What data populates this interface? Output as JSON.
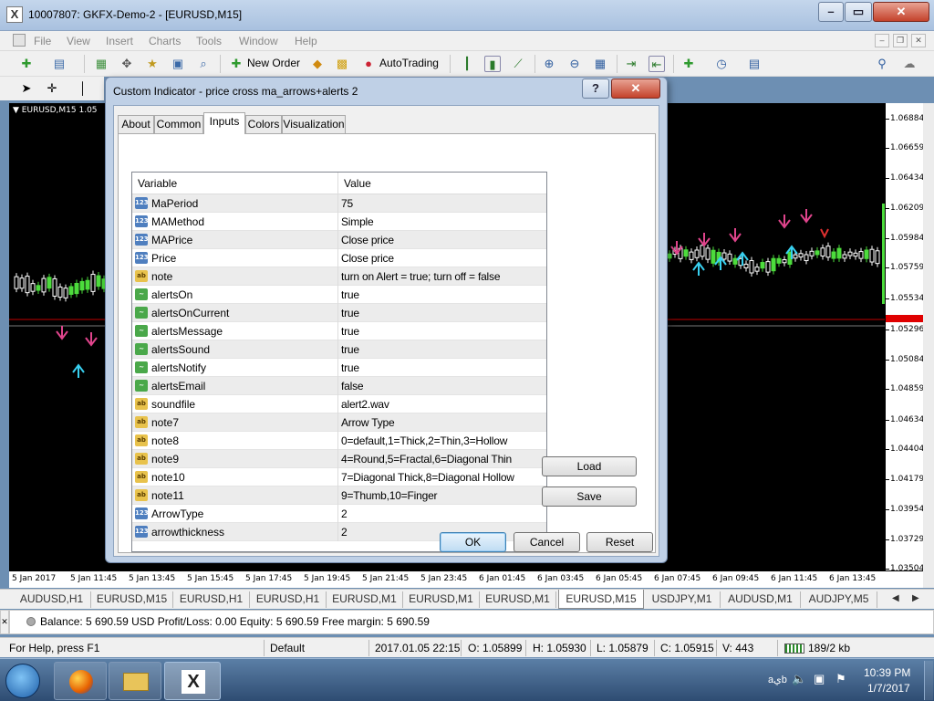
{
  "window": {
    "title": "10007807: GKFX-Demo-2 - [EURUSD,M15]",
    "app_icon": "X"
  },
  "menu": [
    "File",
    "View",
    "Insert",
    "Charts",
    "Tools",
    "Window",
    "Help"
  ],
  "toolbar": {
    "new_order": "New Order",
    "auto_trading": "AutoTrading"
  },
  "chart": {
    "label": "EURUSD,M15  1.05",
    "prices": [
      "1.06884",
      "1.06659",
      "1.06434",
      "1.06209",
      "1.05984",
      "1.05759",
      "1.05534",
      "1.05296",
      "1.05084",
      "1.04859",
      "1.04634",
      "1.04404",
      "1.04179",
      "1.03954",
      "1.03729",
      "1.03504"
    ],
    "current_price": "1.05296",
    "times": [
      "5 Jan 2017",
      "5 Jan 11:45",
      "5 Jan 13:45",
      "5 Jan 15:45",
      "5 Jan 17:45",
      "5 Jan 19:45",
      "5 Jan 21:45",
      "5 Jan 23:45",
      "6 Jan 01:45",
      "6 Jan 03:45",
      "6 Jan 05:45",
      "6 Jan 07:45",
      "6 Jan 09:45",
      "6 Jan 11:45",
      "6 Jan 13:45"
    ],
    "colors": {
      "bull": "#4cdc3c",
      "bear": "#ffffff",
      "up_arrow": "#38d0f0",
      "down_arrow": "#e0448c"
    }
  },
  "dialog": {
    "title": "Custom Indicator - price cross ma_arrows+alerts 2",
    "help_glyph": "?",
    "tabs": [
      "About",
      "Common",
      "Inputs",
      "Colors",
      "Visualization"
    ],
    "active_tab": "Inputs",
    "columns": {
      "variable": "Variable",
      "value": "Value"
    },
    "rows": [
      {
        "type": "int",
        "name": "MaPeriod",
        "value": "75"
      },
      {
        "type": "int",
        "name": "MAMethod",
        "value": "Simple"
      },
      {
        "type": "int",
        "name": "MAPrice",
        "value": "Close price"
      },
      {
        "type": "int",
        "name": "Price",
        "value": "Close price"
      },
      {
        "type": "str",
        "name": "note",
        "value": "turn on Alert = true; turn off = false"
      },
      {
        "type": "bool",
        "name": "alertsOn",
        "value": "true"
      },
      {
        "type": "bool",
        "name": "alertsOnCurrent",
        "value": "true"
      },
      {
        "type": "bool",
        "name": "alertsMessage",
        "value": "true"
      },
      {
        "type": "bool",
        "name": "alertsSound",
        "value": "true"
      },
      {
        "type": "bool",
        "name": "alertsNotify",
        "value": "true"
      },
      {
        "type": "bool",
        "name": "alertsEmail",
        "value": "false"
      },
      {
        "type": "str",
        "name": "soundfile",
        "value": "alert2.wav"
      },
      {
        "type": "str",
        "name": "note7",
        "value": "Arrow Type"
      },
      {
        "type": "str",
        "name": "note8",
        "value": "0=default,1=Thick,2=Thin,3=Hollow"
      },
      {
        "type": "str",
        "name": "note9",
        "value": "4=Round,5=Fractal,6=Diagonal Thin"
      },
      {
        "type": "str",
        "name": "note10",
        "value": "7=Diagonal Thick,8=Diagonal Hollow"
      },
      {
        "type": "str",
        "name": "note11",
        "value": "9=Thumb,10=Finger"
      },
      {
        "type": "int",
        "name": "ArrowType",
        "value": "2"
      },
      {
        "type": "int",
        "name": "arrowthickness",
        "value": "2"
      }
    ],
    "icon_labels": {
      "int": "123",
      "str": "ab",
      "bool": "~"
    },
    "buttons": {
      "load": "Load",
      "save": "Save",
      "ok": "OK",
      "cancel": "Cancel",
      "reset": "Reset"
    }
  },
  "symbol_tabs": [
    "AUDUSD,H1",
    "EURUSD,M15",
    "EURUSD,H1",
    "EURUSD,H1",
    "EURUSD,M1",
    "EURUSD,M1",
    "EURUSD,M1",
    "EURUSD,M15",
    "USDJPY,M1",
    "AUDUSD,M1",
    "AUDJPY,M5"
  ],
  "active_symbol_tab": 7,
  "terminal": {
    "text": "Balance: 5 690.59 USD  Profit/Loss: 0.00  Equity: 5 690.59  Free margin: 5 690.59"
  },
  "status": {
    "help": "For Help, press F1",
    "profile": "Default",
    "datetime": "2017.01.05 22:15",
    "open": "O: 1.05899",
    "high": "H: 1.05930",
    "low": "L: 1.05879",
    "close": "C: 1.05915",
    "volume": "V: 443",
    "traffic": "189/2 kb"
  },
  "taskbar": {
    "time": "10:39 PM",
    "date": "1/7/2017",
    "lang": "aيb"
  }
}
